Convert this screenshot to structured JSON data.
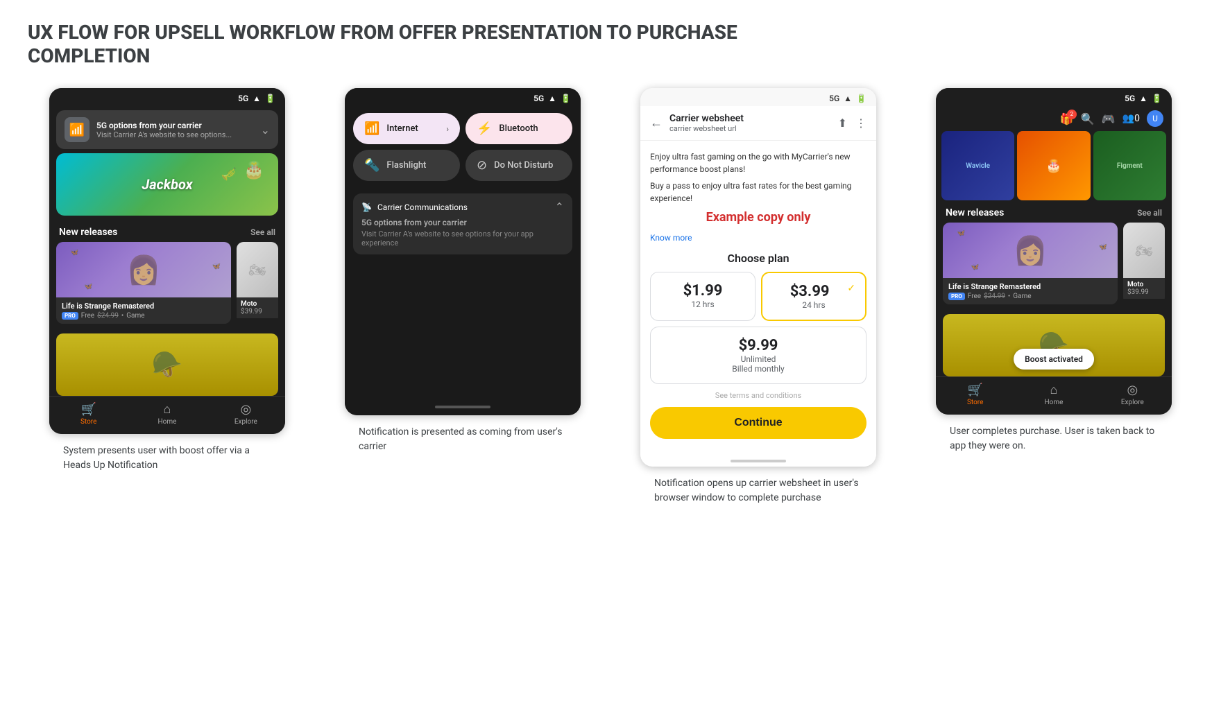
{
  "page": {
    "title": "UX FLOW FOR UPSELL WORKFLOW FROM OFFER PRESENTATION TO PURCHASE COMPLETION"
  },
  "screens": [
    {
      "id": "screen1",
      "status": "5G",
      "notification": {
        "icon": "📶",
        "title": "5G options from your carrier",
        "sub": "Visit Carrier A's website to see options..."
      },
      "hero": {
        "text": "Jackbox"
      },
      "section": "New releases",
      "see_all": "See all",
      "games": [
        {
          "title": "Life is Strange Remastered",
          "badge": "PRO",
          "price_free": "Free",
          "price_original": "$24.99",
          "type": "Game"
        },
        {
          "title": "Moto",
          "price": "$39.99"
        }
      ],
      "nav": [
        {
          "label": "Store",
          "icon": "🛒",
          "active": true
        },
        {
          "label": "Home",
          "icon": "⌂",
          "active": false
        },
        {
          "label": "Explore",
          "icon": "◎",
          "active": false
        }
      ],
      "caption": "System presents user with boost offer via a Heads Up Notification"
    },
    {
      "id": "screen2",
      "status": "5G",
      "tiles": [
        {
          "label": "Internet",
          "icon": "📶",
          "active": true,
          "theme": "internet",
          "arrow": true
        },
        {
          "label": "Bluetooth",
          "icon": "⚡",
          "active": true,
          "theme": "bluetooth",
          "arrow": false
        },
        {
          "label": "Flashlight",
          "icon": "🔦",
          "active": false,
          "theme": "",
          "arrow": false
        },
        {
          "label": "Do Not Disturb",
          "icon": "⊘",
          "active": false,
          "theme": "",
          "arrow": false
        }
      ],
      "notification": {
        "title": "Carrier Communications",
        "body": "5G options from your carrier",
        "sub": "Visit Carrier A's website to see options for your app experience"
      },
      "caption": "Notification is presented as coming from user's carrier"
    },
    {
      "id": "screen3",
      "status": "5G",
      "header": {
        "back": "←",
        "title": "Carrier websheet",
        "url": "carrier websheet url",
        "share": "⬆",
        "more": "⋮"
      },
      "body_copy": "Enjoy ultra fast gaming on the go with MyCarrier's new performance boost plans!",
      "body_copy2": "Buy a pass to enjoy ultra fast rates for the best gaming experience!",
      "example_copy": "Example copy only",
      "know_more": "Know more",
      "choose_plan": "Choose plan",
      "plans": [
        {
          "price": "$1.99",
          "duration": "12 hrs",
          "selected": false
        },
        {
          "price": "$3.99",
          "duration": "24 hrs",
          "selected": true
        }
      ],
      "plan_wide": {
        "price": "$9.99",
        "duration": "Unlimited",
        "billing": "Billed monthly"
      },
      "terms": "See terms and conditions",
      "continue_btn": "Continue",
      "caption": "Notification opens up carrier websheet in user's browser window to complete purchase"
    },
    {
      "id": "screen4",
      "status": "5G",
      "section": "New releases",
      "see_all": "See all",
      "games": [
        {
          "title": "Life is Strange Remastered",
          "badge": "PRO",
          "price_free": "Free",
          "price_original": "$24.99",
          "type": "Game"
        },
        {
          "title": "Moto",
          "price": "$39.99"
        }
      ],
      "boost_activated": "Boost activated",
      "nav": [
        {
          "label": "Store",
          "icon": "🛒",
          "active": true
        },
        {
          "label": "Home",
          "icon": "⌂",
          "active": false
        },
        {
          "label": "Explore",
          "icon": "◎",
          "active": false
        }
      ],
      "caption": "User completes purchase. User is taken back to app they were on."
    }
  ]
}
